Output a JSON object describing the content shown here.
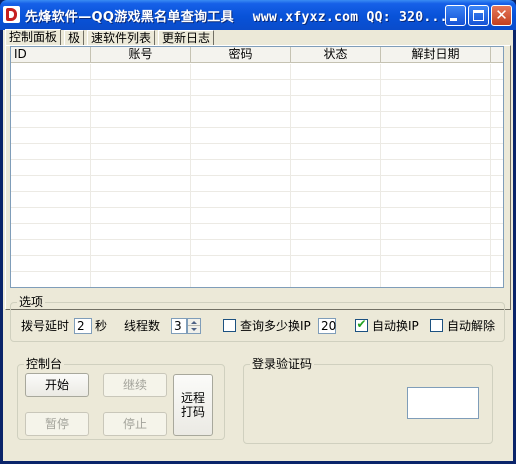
{
  "window": {
    "title_cn": "先烽软件—QQ游戏黑名单查询工具",
    "title_rest": "www.xfyxz.com QQ: 320..."
  },
  "tabs": [
    {
      "label": "控制面板"
    },
    {
      "label": "极"
    },
    {
      "label": "速软件列表"
    },
    {
      "label": "更新日志"
    }
  ],
  "table": {
    "columns": [
      "ID",
      "账号",
      "密码",
      "状态",
      "解封日期"
    ],
    "rows": []
  },
  "options": {
    "group_label": "选项",
    "dial_delay_label": "拨号延时",
    "dial_delay_value": "2",
    "dial_delay_unit": "秒",
    "threads_label": "线程数",
    "threads_value": "3",
    "query_change_ip_label": "查询多少换IP",
    "query_change_ip_value": "20",
    "query_change_ip_checked": false,
    "auto_change_ip_label": "自动换IP",
    "auto_change_ip_checked": true,
    "auto_unban_label": "自动解除",
    "auto_unban_checked": false
  },
  "control": {
    "group_label": "控制台",
    "start_label": "开始",
    "continue_label": "继续",
    "pause_label": "暂停",
    "stop_label": "停止",
    "remote_code_line1": "远程",
    "remote_code_line2": "打码"
  },
  "login": {
    "group_label": "登录验证码"
  },
  "colors": {
    "titlebar": "#0A52D8",
    "face": "#ECE9D8",
    "check": "#21A121"
  },
  "icons": {
    "app": "app-logo-icon",
    "minimize": "minimize-icon",
    "maximize": "maximize-icon",
    "close": "close-icon"
  }
}
